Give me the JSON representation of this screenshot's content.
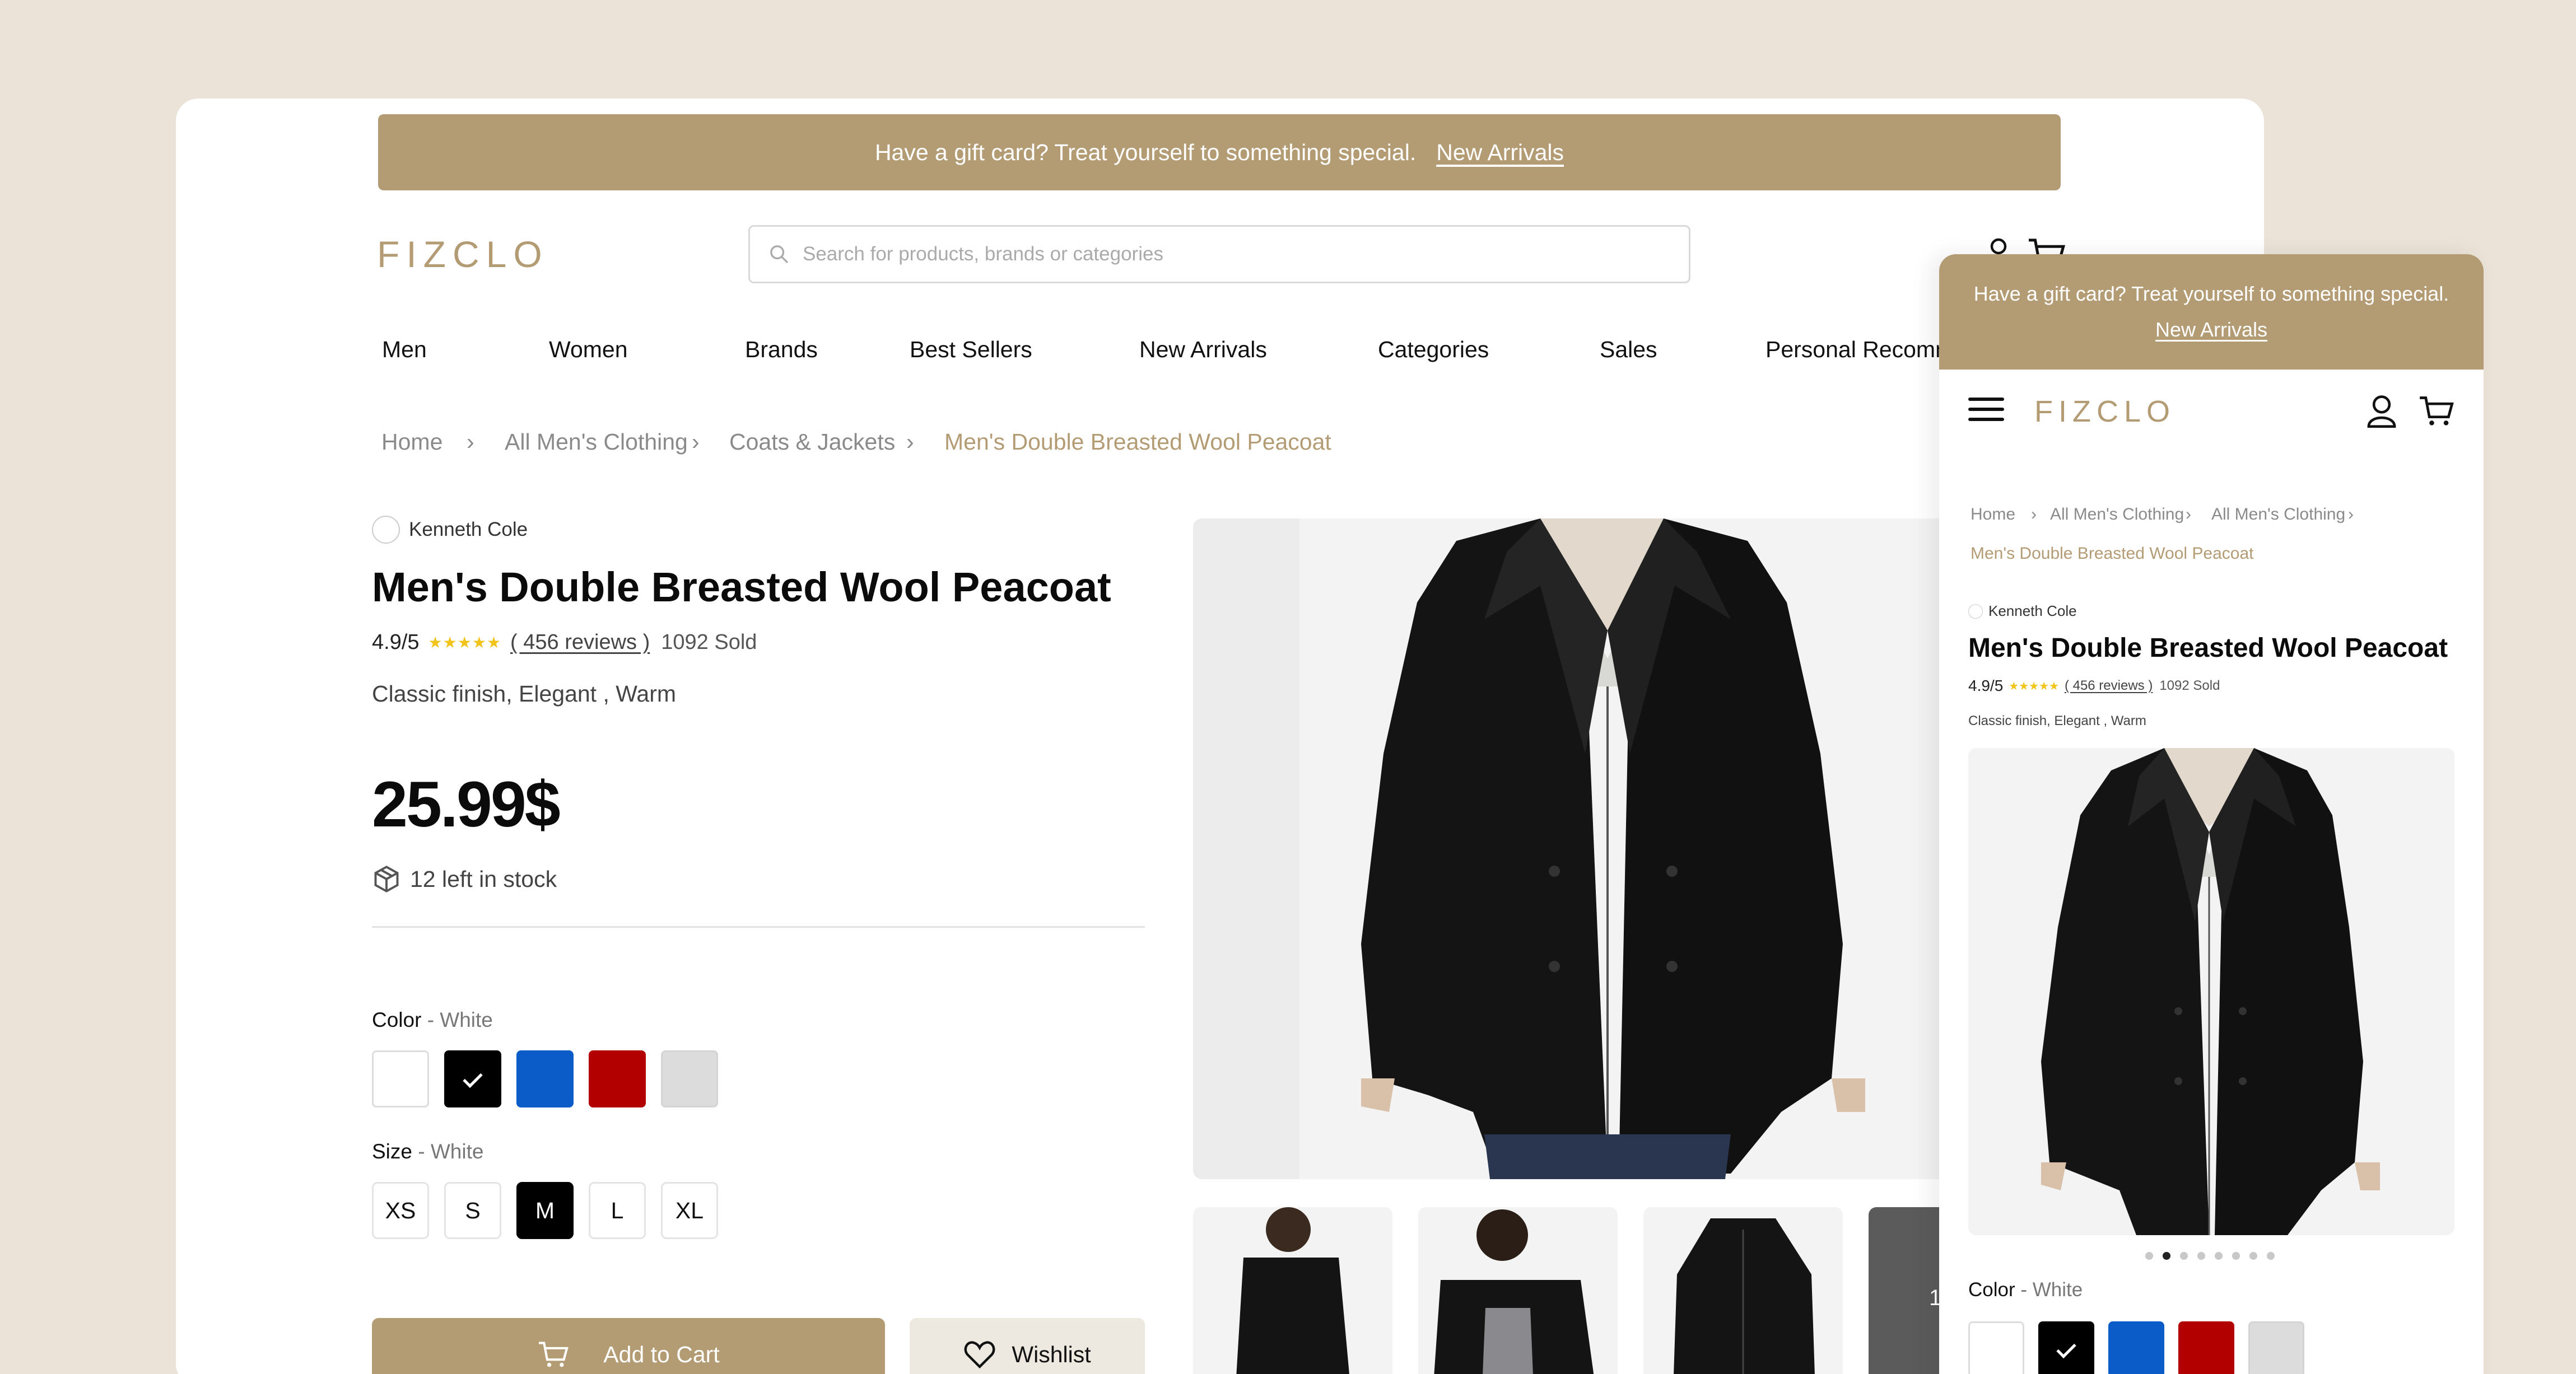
{
  "promo": {
    "text": "Have a gift card? Treat yourself to something special.",
    "link": "New Arrivals"
  },
  "logo": "FIZCLO",
  "search": {
    "placeholder": "Search for products, brands or categories"
  },
  "nav": [
    "Men",
    "Women",
    "Brands",
    "Best Sellers",
    "New Arrivals",
    "Categories",
    "Sales",
    "Personal Recomm"
  ],
  "breadcrumb": {
    "items": [
      "Home",
      "All Men's Clothing",
      "Coats & Jackets"
    ],
    "current": "Men's Double Breasted Wool Peacoat"
  },
  "product": {
    "brand": "Kenneth Cole",
    "title": "Men's Double Breasted Wool Peacoat",
    "rating": "4.9/5",
    "stars": "★★★★★",
    "reviews": "( 456 reviews )",
    "sold": "1092 Sold",
    "tags": "Classic finish, Elegant , Warm",
    "price": "25.99$",
    "stock": "12 left in stock",
    "color_label": "Color",
    "color_value": "- White",
    "colors": [
      "#ffffff",
      "#000000",
      "#0b5cc8",
      "#b20000",
      "#dcdcdc"
    ],
    "size_label": "Size",
    "size_value": "- White",
    "sizes": [
      "XS",
      "S",
      "M",
      "L",
      "XL"
    ],
    "selected_size": "M",
    "add_to_cart": "Add to Cart",
    "wishlist": "Wishlist",
    "thumb_badge": "12"
  },
  "mobile": {
    "breadcrumb": {
      "items": [
        "Home",
        "All Men's Clothing",
        "All Men's Clothing"
      ],
      "current": "Men's Double Breasted Wool Peacoat"
    },
    "reviews": "( 456 reviews )",
    "carousel_pages": 8,
    "carousel_active": 1
  },
  "colors": {
    "accent": "#b39b74",
    "background": "#ebe3d8"
  }
}
